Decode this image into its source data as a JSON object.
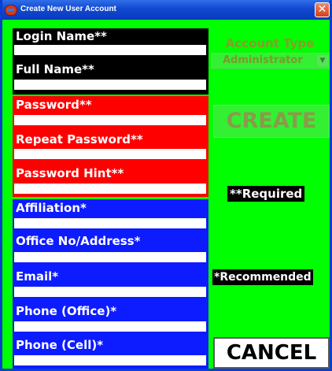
{
  "window": {
    "title": "Create New User Account",
    "close_glyph": "✕"
  },
  "form": {
    "login_name_label": "Login Name**",
    "full_name_label": "Full Name**",
    "password_label": "Password**",
    "repeat_password_label": "Repeat Password**",
    "password_hint_label": "Password Hint**",
    "affiliation_label": "Affiliation*",
    "office_label": "Office No/Address*",
    "email_label": "Email*",
    "phone_office_label": "Phone (Office)*",
    "phone_cell_label": "Phone (Cell)*",
    "login_name_value": "",
    "full_name_value": "",
    "password_value": "",
    "repeat_password_value": "",
    "password_hint_value": "",
    "affiliation_value": "",
    "office_value": "",
    "email_value": "",
    "phone_office_value": "",
    "phone_cell_value": ""
  },
  "side": {
    "account_type_label": "Account Type",
    "account_type_value": "Administrator",
    "create_label": "CREATE",
    "required_note": "**Required",
    "recommended_note": "*Recommended",
    "cancel_label": "CANCEL"
  },
  "colors": {
    "required_section": "#000000",
    "password_section": "#ff0000",
    "recommended_section": "#0d1cff",
    "side_panel": "#00ff00"
  },
  "icons": {
    "app_icon": "app-icon",
    "close_icon": "close-icon",
    "dropdown_icon": "chevron-down-icon"
  }
}
